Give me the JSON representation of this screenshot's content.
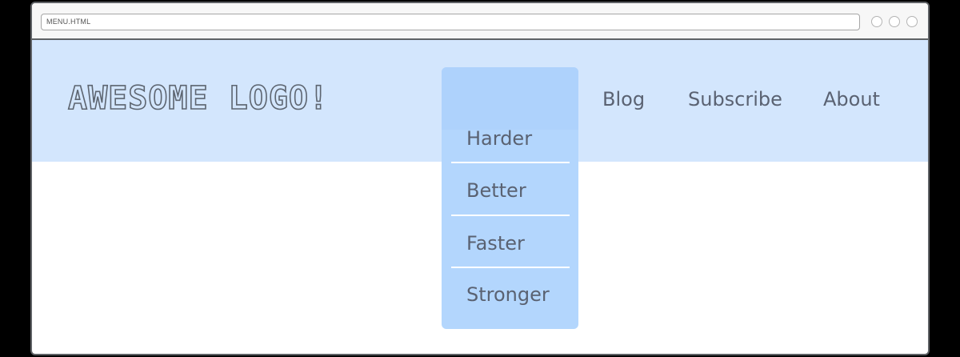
{
  "browser": {
    "url": "MENU.HTML"
  },
  "header": {
    "logo": "AWESOME LOGO!",
    "nav": [
      {
        "label": "Blog"
      },
      {
        "label": "Subscribe"
      },
      {
        "label": "About"
      }
    ]
  },
  "dropdown": {
    "items": [
      {
        "label": "Harder"
      },
      {
        "label": "Better"
      },
      {
        "label": "Faster"
      },
      {
        "label": "Stronger"
      }
    ]
  },
  "colors": {
    "header_bg": "#d3e6fd",
    "dropdown_bg": "#b3d6fd",
    "text": "#5a6272",
    "frame": "#5f6266"
  }
}
